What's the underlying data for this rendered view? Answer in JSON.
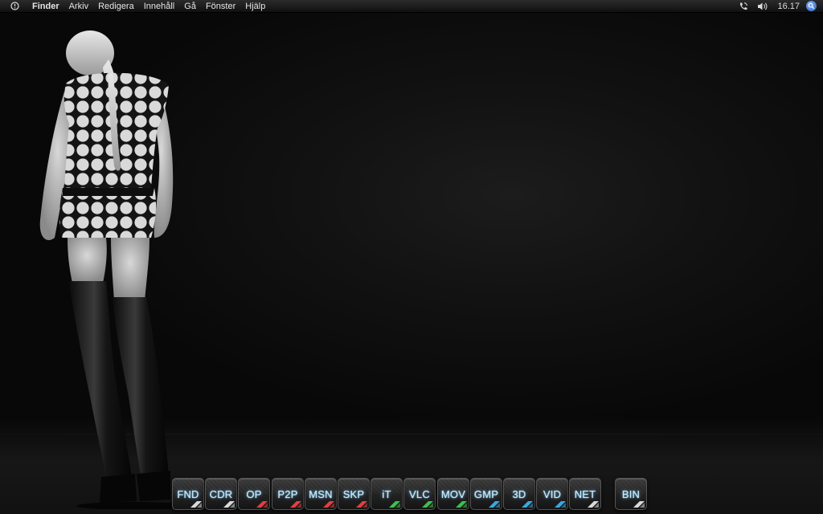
{
  "menubar": {
    "app": "Finder",
    "items": [
      "Arkiv",
      "Redigera",
      "Innehåll",
      "Gå",
      "Fönster",
      "Hjälp"
    ],
    "clock": "16.17",
    "status_icons": [
      "phone-icon",
      "volume-icon",
      "spotlight-icon"
    ]
  },
  "dock": {
    "items": [
      {
        "label": "FND",
        "accent": "#d9d9d9"
      },
      {
        "label": "CDR",
        "accent": "#d9d9d9"
      },
      {
        "label": "OP",
        "accent": "#e04040"
      },
      {
        "label": "P2P",
        "accent": "#e04040"
      },
      {
        "label": "MSN",
        "accent": "#e04040"
      },
      {
        "label": "SKP",
        "accent": "#e04040"
      },
      {
        "label": "iT",
        "accent": "#3fbf4f"
      },
      {
        "label": "VLC",
        "accent": "#3fbf4f"
      },
      {
        "label": "MOV",
        "accent": "#3fbf4f"
      },
      {
        "label": "GMP",
        "accent": "#3aa7e0"
      },
      {
        "label": "3D",
        "accent": "#3aa7e0"
      },
      {
        "label": "VID",
        "accent": "#3aa7e0"
      },
      {
        "label": "NET",
        "accent": "#d9d9d9"
      },
      {
        "label": "BIN",
        "accent": "#d9d9d9"
      }
    ]
  }
}
